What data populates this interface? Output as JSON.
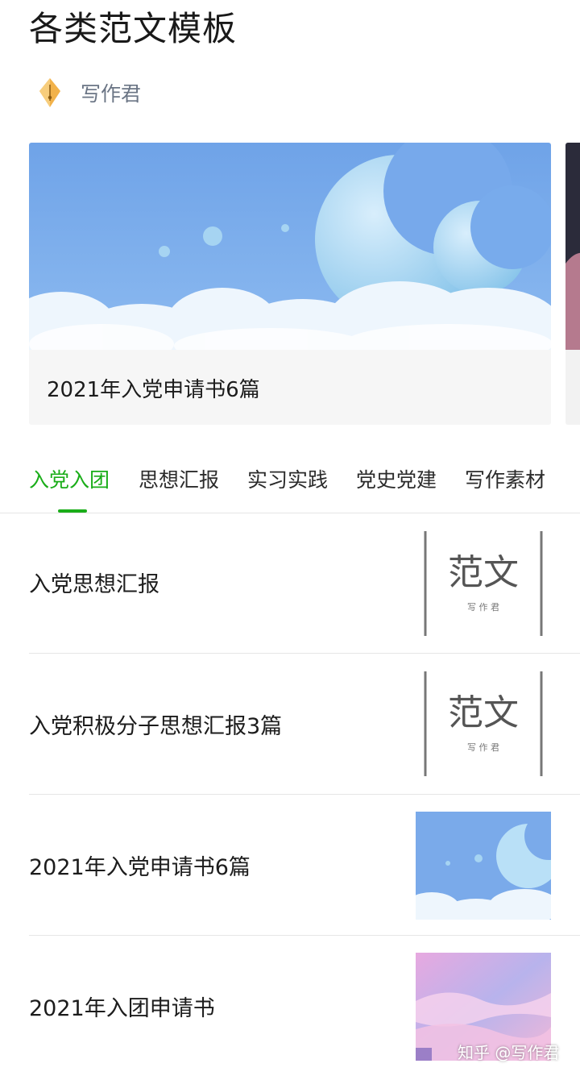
{
  "page": {
    "title": "各类范文模板"
  },
  "author": {
    "name": "写作君",
    "icon": "pen-nib-icon"
  },
  "carousel": {
    "caption": "2021年入党申请书6篇"
  },
  "tabs": [
    {
      "label": "入党入团",
      "active": true
    },
    {
      "label": "思想汇报",
      "active": false
    },
    {
      "label": "实习实践",
      "active": false
    },
    {
      "label": "党史党建",
      "active": false
    },
    {
      "label": "写作素材",
      "active": false
    }
  ],
  "articles": [
    {
      "title": "入党思想汇报",
      "thumb": {
        "kind": "fanwen-logo",
        "big": "范文",
        "small": "写 作 君"
      }
    },
    {
      "title": "入党积极分子思想汇报3篇",
      "thumb": {
        "kind": "fanwen-logo",
        "big": "范文",
        "small": "写 作 君"
      }
    },
    {
      "title": "2021年入党申请书6篇",
      "thumb": {
        "kind": "moon-sky"
      }
    },
    {
      "title": "2021年入团申请书",
      "thumb": {
        "kind": "pink-sky"
      }
    }
  ],
  "watermark": {
    "text": "知乎 @写作君"
  },
  "colors": {
    "accent": "#1aad19",
    "sky": "#7aaaea",
    "author_text": "#6b7585"
  }
}
